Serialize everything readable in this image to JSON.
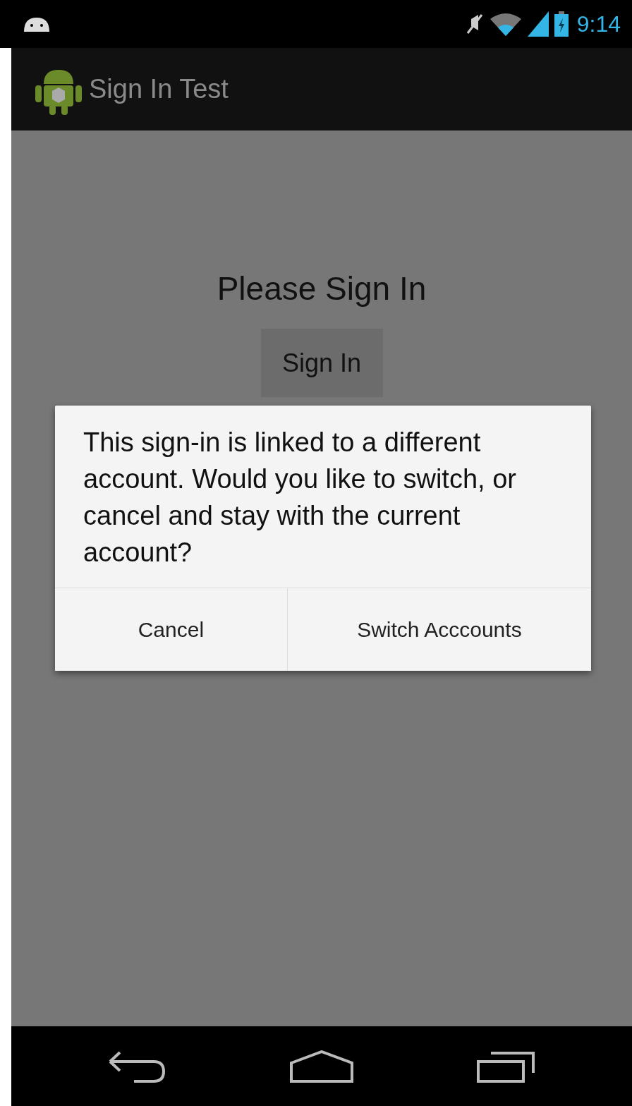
{
  "status_bar": {
    "time": "9:14"
  },
  "app_bar": {
    "title": "Sign In Test"
  },
  "content": {
    "heading": "Please Sign In",
    "button": "Sign In"
  },
  "dialog": {
    "message": "This sign-in is linked to a different account. Would you like to switch, or cancel and stay with the current account?",
    "buttons": [
      "Cancel",
      "Switch Acccounts"
    ]
  }
}
